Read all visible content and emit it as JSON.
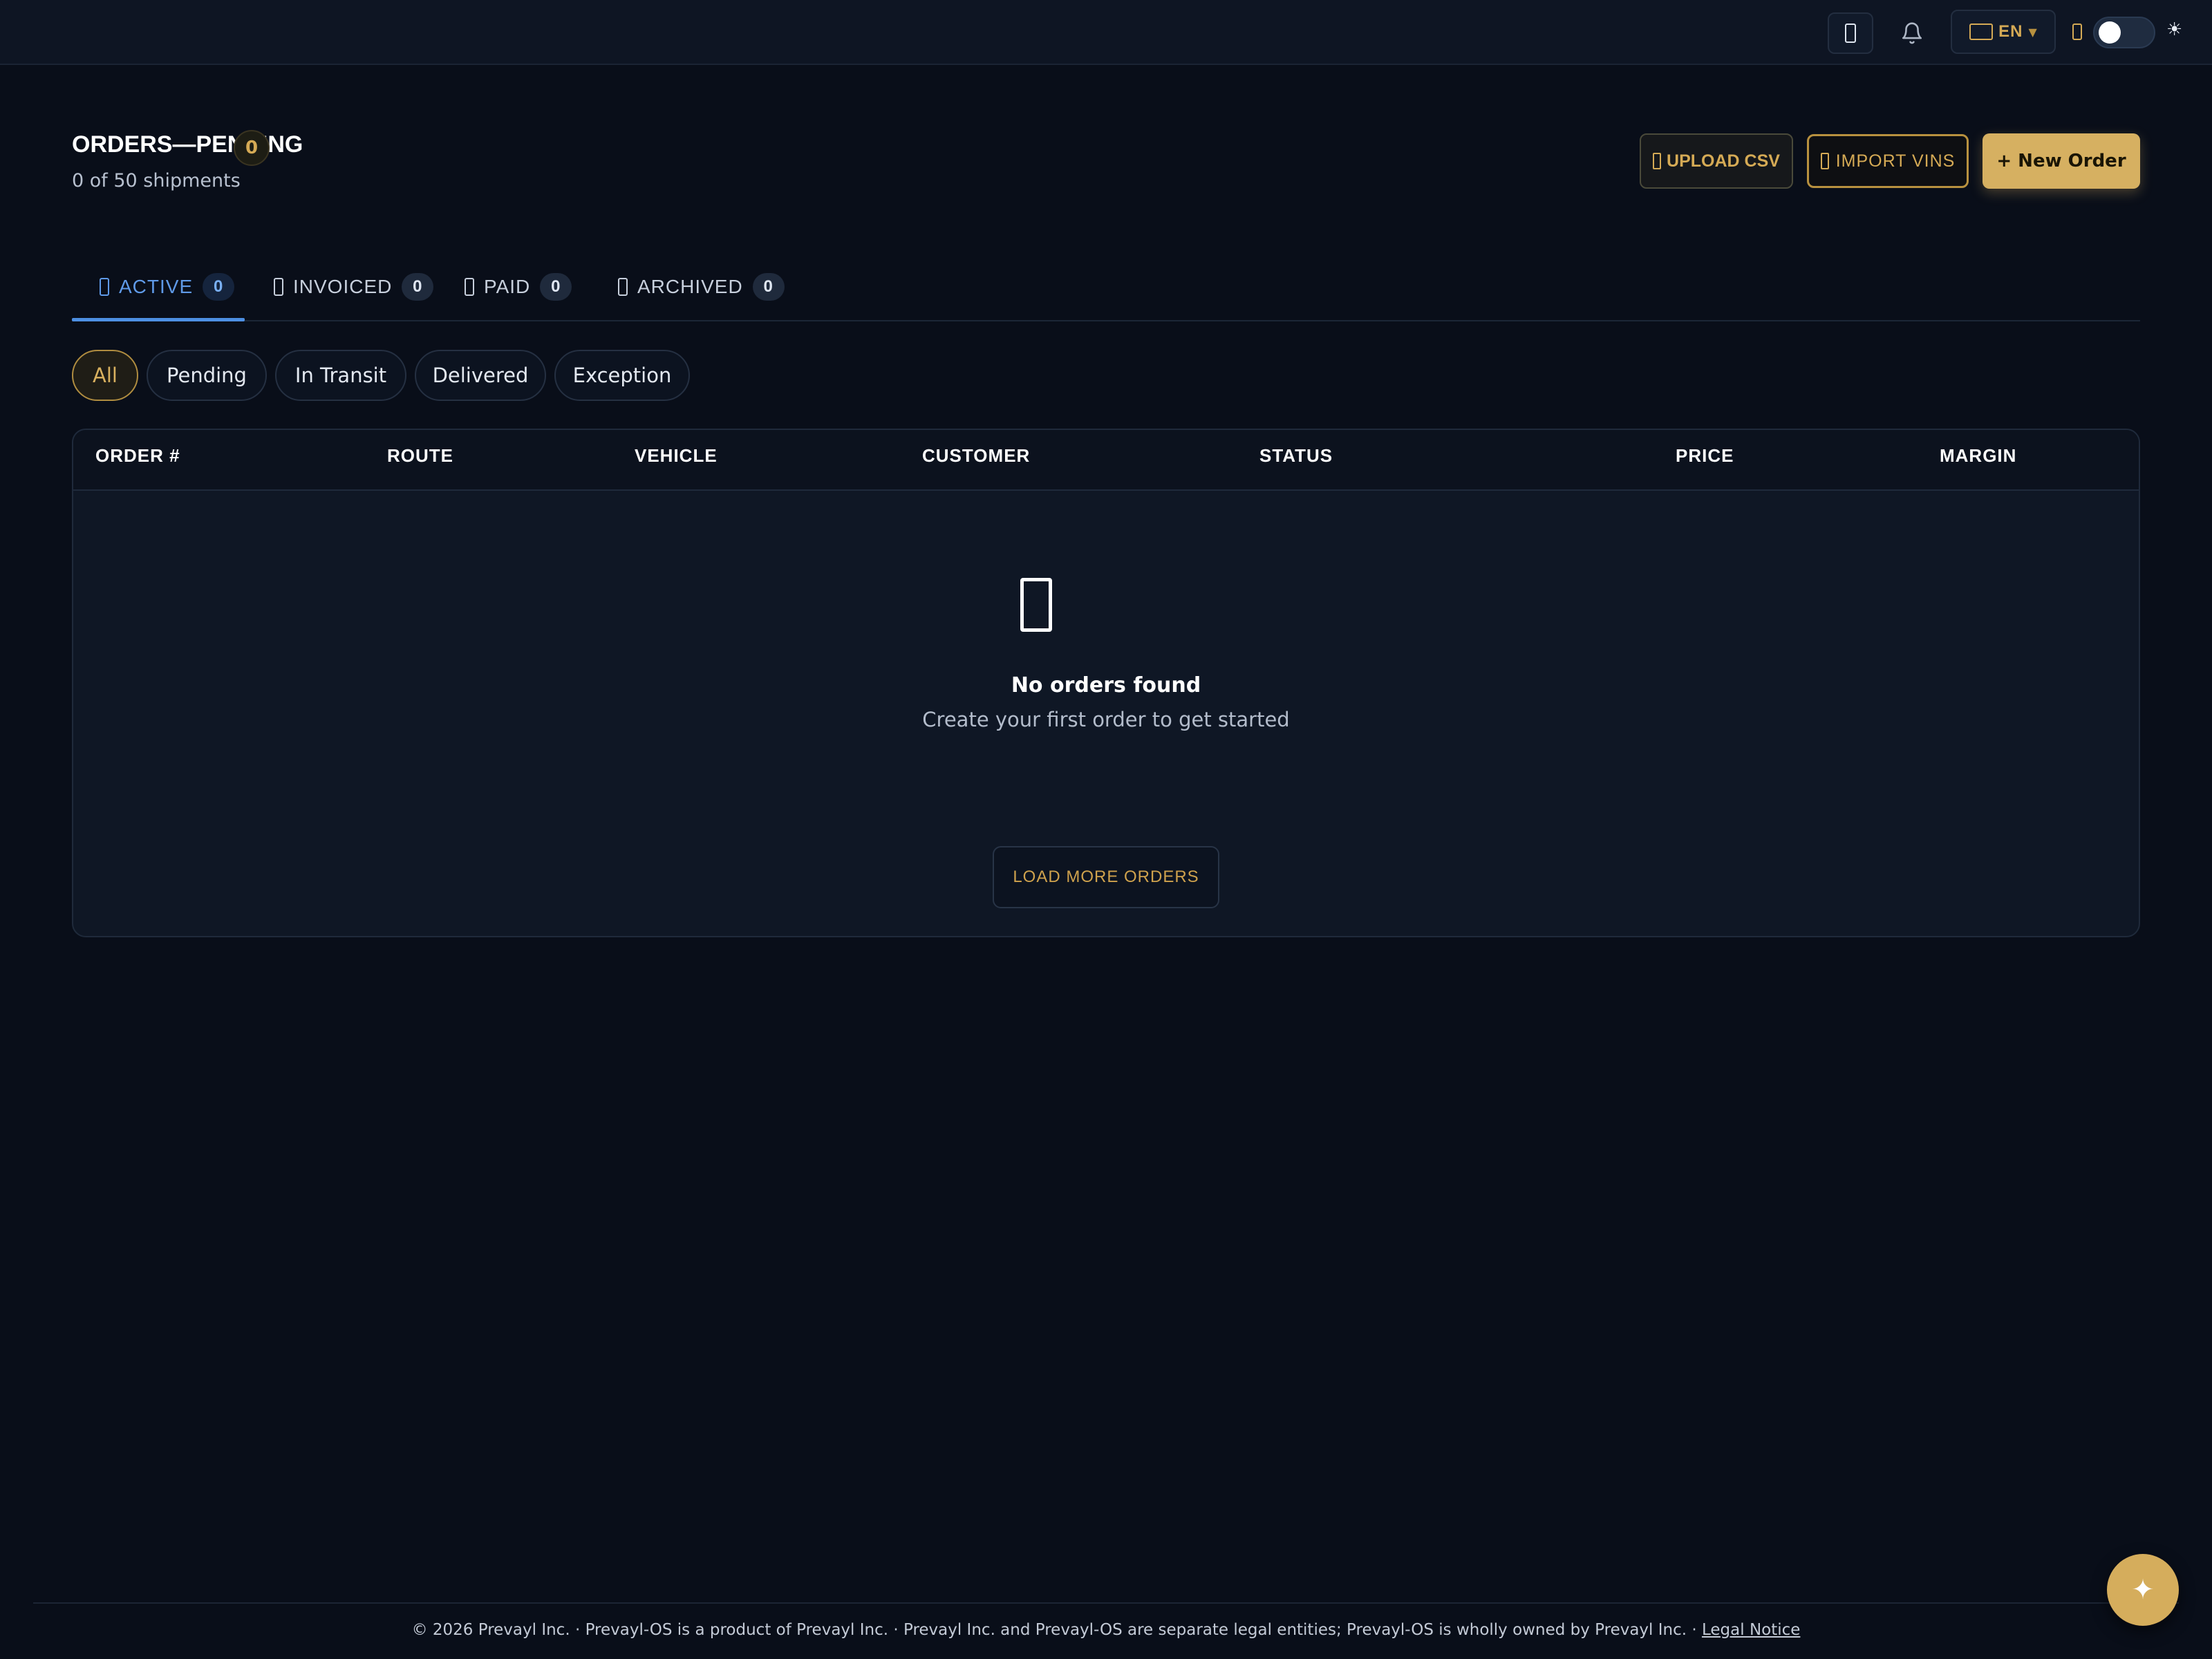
{
  "topbar": {
    "icons": [
      "device-icon",
      "bell-icon",
      "flag-icon",
      "moon-icon",
      "sun-icon"
    ],
    "language": {
      "label": "EN",
      "caret": "▼"
    },
    "theme_sun": "☀"
  },
  "header": {
    "title": "ORDERS—PENDING",
    "count": "0",
    "subtitle": "0 of 50 shipments",
    "upload_csv": "UPLOAD CSV",
    "import_vins": "IMPORT VINS",
    "new_order": "+ New Order"
  },
  "tabs": [
    {
      "label": "ACTIVE",
      "count": "0",
      "active": true
    },
    {
      "label": "INVOICED",
      "count": "0"
    },
    {
      "label": "PAID",
      "count": "0"
    },
    {
      "label": "ARCHIVED",
      "count": "0"
    }
  ],
  "filters": [
    "All",
    "Pending",
    "In Transit",
    "Delivered",
    "Exception"
  ],
  "table": {
    "columns": [
      "ORDER #",
      "ROUTE",
      "VEHICLE",
      "CUSTOMER",
      "STATUS",
      "PRICE",
      "MARGIN"
    ],
    "rows": [],
    "empty_title": "No orders found",
    "empty_subtitle": "Create your first order to get started",
    "load_more": "LOAD MORE ORDERS"
  },
  "footer": {
    "text": "© 2026 Prevayl Inc. · Prevayl-OS is a product of Prevayl Inc. · Prevayl Inc. and Prevayl-OS are separate legal entities; Prevayl-OS is wholly owned by Prevayl Inc. ·",
    "legal_link": "Legal Notice"
  },
  "fab": {
    "glyph": "✦"
  },
  "colors": {
    "accent_gold": "#d6b061",
    "accent_blue": "#4d8fe3",
    "background": "#090e19"
  }
}
